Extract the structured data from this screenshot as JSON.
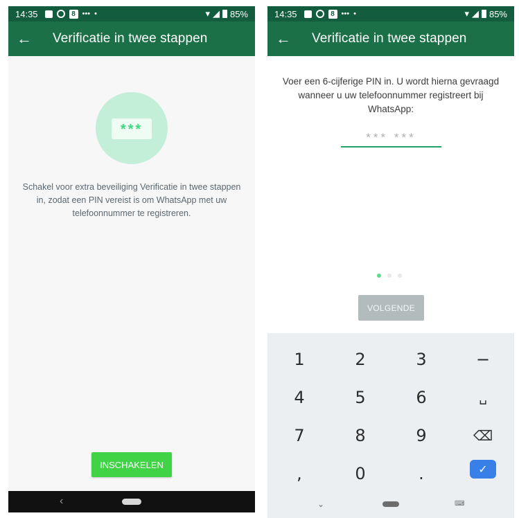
{
  "left": {
    "status": {
      "time": "14:35",
      "battery": "85%"
    },
    "appbar": {
      "back": "←",
      "title": "Verificatie in twee stappen"
    },
    "hero": {
      "pin_mask": "***"
    },
    "description": "Schakel voor extra beveiliging Verificatie in twee stappen in, zodat een PIN vereist is om WhatsApp met uw telefoonnummer te registreren.",
    "enable_button": "INSCHAKELEN",
    "nav": {
      "back": "‹"
    }
  },
  "right": {
    "status": {
      "time": "14:35",
      "battery": "85%"
    },
    "appbar": {
      "back": "←",
      "title": "Verificatie in twee stappen"
    },
    "description": "Voer een 6-cijferige PIN in. U wordt hierna gevraagd wanneer u uw telefoonnummer registreert bij WhatsApp:",
    "pin_placeholder": "*** ***",
    "pager": {
      "current": 1,
      "total": 3
    },
    "next_button": "VOLGENDE",
    "keyboard": {
      "keys": [
        "1",
        "2",
        "3",
        "−",
        "4",
        "5",
        "6",
        "␣",
        "7",
        "8",
        "9",
        "⌫",
        ",",
        "0",
        "."
      ],
      "enter": "✓"
    }
  },
  "colors": {
    "statusbar": "#145c3e",
    "appbar": "#1b7047",
    "accent": "#41d346",
    "pin_underline": "#1fa463",
    "next_disabled": "#b2bcbd",
    "keyboard_bg": "#eceff1",
    "enter_key": "#3880e8"
  },
  "icons": {
    "status": [
      "image-icon",
      "radar-icon",
      "eight-icon",
      "dots-icon",
      "wifi-icon",
      "signal-icon",
      "battery-icon"
    ],
    "back": "arrow-left-icon",
    "backspace": "backspace-icon",
    "space": "space-icon",
    "enter": "check-icon"
  }
}
